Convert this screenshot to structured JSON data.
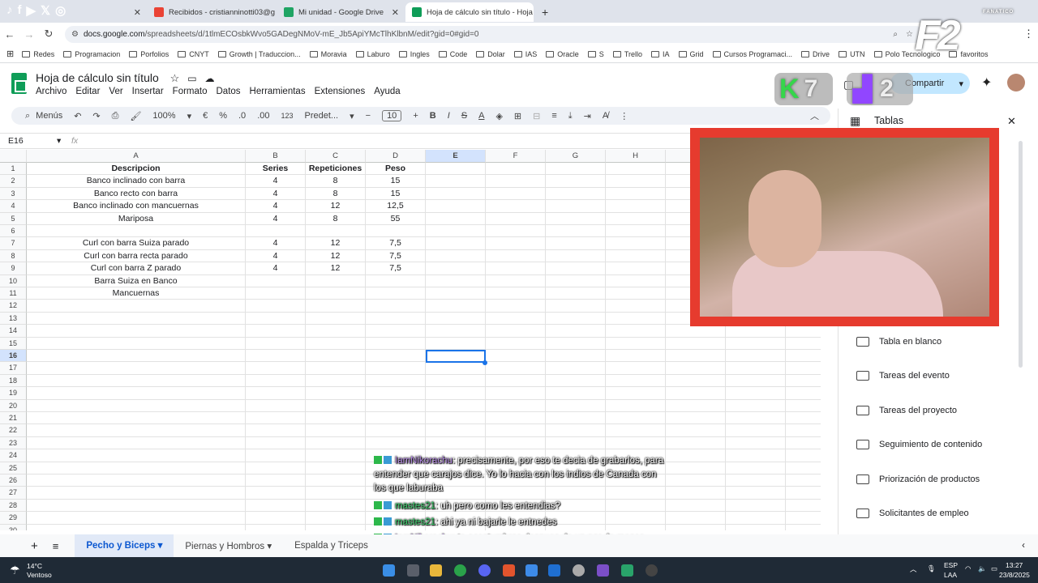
{
  "browser": {
    "tabs": [
      {
        "label": "Recibidos - cristianninotti03@g",
        "icon": "gmail-icon",
        "color": "#ea4335"
      },
      {
        "label": "Mi unidad - Google Drive",
        "icon": "drive-icon",
        "color": "#1fa463"
      },
      {
        "label": "Hoja de cálculo sin título - Hoja",
        "icon": "sheets-icon",
        "color": "#0f9d58"
      }
    ],
    "url_host": "docs.google.com",
    "url_path": "/spreadsheets/d/1tlmECOsbkWvo5GADegNMoV-mE_Jb5ApiYMcTlhKlbnM/edit?gid=0#gid=0",
    "bookmarks": [
      "Redes",
      "Programacion",
      "Porfolios",
      "CNYT",
      "Growth | Traduccion...",
      "Moravia",
      "Laburo",
      "Ingles",
      "Code",
      "Dolar",
      "IAS",
      "Oracle",
      "S",
      "Trello",
      "IA",
      "Grid",
      "Cursos Programaci...",
      "Drive",
      "UTN",
      "Polo Tecnologico",
      "favoritos"
    ]
  },
  "sheets": {
    "title": "Hoja de cálculo sin título",
    "menu": [
      "Archivo",
      "Editar",
      "Ver",
      "Insertar",
      "Formato",
      "Datos",
      "Herramientas",
      "Extensiones",
      "Ayuda"
    ],
    "toolbar": {
      "search": "Menús",
      "zoom": "100%",
      "currency": "€",
      "percent": "%",
      "dec_down": ".0",
      "dec_up": ".00",
      "num_format": "123",
      "font": "Predet...",
      "font_size": "10"
    },
    "share_label": "Compartir",
    "cell_ref": "E16",
    "fx": "fx",
    "columns": [
      "A",
      "B",
      "C",
      "D",
      "E",
      "F",
      "G",
      "H"
    ],
    "rows": [
      [
        "Descripcion",
        "Series",
        "Repeticiones",
        "Peso"
      ],
      [
        "Banco inclinado con barra",
        "4",
        "8",
        "15"
      ],
      [
        "Banco recto con barra",
        "4",
        "8",
        "15"
      ],
      [
        "Banco inclinado con mancuernas",
        "4",
        "12",
        "12,5"
      ],
      [
        "Mariposa",
        "4",
        "8",
        "55"
      ],
      [
        "",
        "",
        "",
        ""
      ],
      [
        "Curl con barra Suiza parado",
        "4",
        "12",
        "7,5"
      ],
      [
        "Curl con barra recta parado",
        "4",
        "12",
        "7,5"
      ],
      [
        "Curl con barra Z parado",
        "4",
        "12",
        "7,5"
      ],
      [
        "Barra Suiza en Banco",
        "",
        "",
        ""
      ],
      [
        "Mancuernas",
        "",
        "",
        ""
      ]
    ],
    "row_numbers": [
      "1",
      "2",
      "3",
      "4",
      "5",
      "6",
      "7",
      "8",
      "9",
      "10",
      "11",
      "12",
      "13",
      "14",
      "15",
      "16",
      "17",
      "18",
      "19",
      "20",
      "21",
      "22",
      "23",
      "24",
      "25",
      "26",
      "27",
      "28",
      "29",
      "30"
    ],
    "sheet_tabs": [
      "Pecho y Biceps",
      "Piernas y Hombros",
      "Espalda y Triceps"
    ]
  },
  "panel": {
    "title": "Tablas",
    "items": [
      "Tabla en blanco",
      "Tareas del evento",
      "Tareas del proyecto",
      "Seguimiento de contenido",
      "Priorización de productos",
      "Solicitantes de empleo"
    ]
  },
  "stream": {
    "kick_count": "7",
    "twitch_count": "2",
    "logo_text": "F2",
    "logo_sub": "FANATICO",
    "chat": [
      {
        "user": "IamNikorachu",
        "msg": ": precisamente, por eso te decia de grabarlos, para entender que carajos dice. Yo lo hacia con los indios de Canada con los que laburaba",
        "cls": "u1"
      },
      {
        "user": "mastes21",
        "msg": ": uh pero como les entendias?",
        "cls": "u2"
      },
      {
        "user": "mastes21",
        "msg": ": ahi ya ni bajarle le entnedes",
        "cls": "u2"
      },
      {
        "user": "IamNikorachu",
        "msg": ": te acostumbras despues de un par de meses",
        "cls": "u1"
      }
    ]
  },
  "taskbar": {
    "temp": "14°C",
    "weather": "Ventoso",
    "lang1": "ESP",
    "lang2": "LAA",
    "time": "13:27",
    "date": "23/8/2025"
  }
}
